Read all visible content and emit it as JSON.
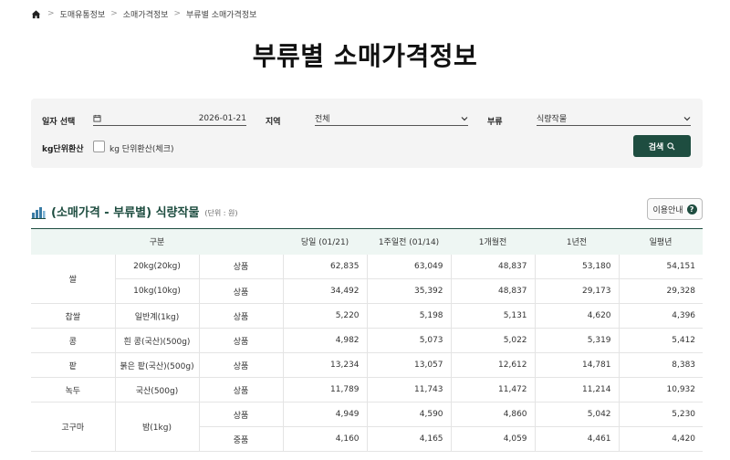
{
  "breadcrumb": {
    "items": [
      "도매유통정보",
      "소매가격정보",
      "부류별 소매가격정보"
    ]
  },
  "page": {
    "title": "부류별 소매가격정보"
  },
  "filters": {
    "date_label": "일자 선택",
    "date_value": "2026-01-21",
    "region_label": "지역",
    "region_value": "전체",
    "category_label": "부류",
    "category_value": "식량작물",
    "kg_label": "kg단위환산",
    "kg_checkbox_label": "kg 단위환산(체크)",
    "search_label": "검색"
  },
  "section": {
    "title": "(소매가격 - 부류별) 식량작물",
    "unit": "(단위 : 원)",
    "guide_label": "이용안내"
  },
  "table": {
    "headers": {
      "category": "구분",
      "today": "당일 (01/21)",
      "week": "1주일전 (01/14)",
      "month": "1개월전",
      "year": "1년전",
      "avg": "일평년"
    },
    "rows": [
      {
        "item": "쌀",
        "variety": "20kg(20kg)",
        "grade": "상품",
        "today": "62,835",
        "week": "63,049",
        "month": "48,837",
        "year": "53,180",
        "avg": "54,151"
      },
      {
        "item": "",
        "variety": "10kg(10kg)",
        "grade": "상품",
        "today": "34,492",
        "week": "35,392",
        "month": "48,837",
        "year": "29,173",
        "avg": "29,328"
      },
      {
        "item": "찹쌀",
        "variety": "일반계(1kg)",
        "grade": "상품",
        "today": "5,220",
        "week": "5,198",
        "month": "5,131",
        "year": "4,620",
        "avg": "4,396"
      },
      {
        "item": "콩",
        "variety": "흰 콩(국산)(500g)",
        "grade": "상품",
        "today": "4,982",
        "week": "5,073",
        "month": "5,022",
        "year": "5,319",
        "avg": "5,412"
      },
      {
        "item": "팥",
        "variety": "붉은 팥(국산)(500g)",
        "grade": "상품",
        "today": "13,234",
        "week": "13,057",
        "month": "12,612",
        "year": "14,781",
        "avg": "8,383"
      },
      {
        "item": "녹두",
        "variety": "국산(500g)",
        "grade": "상품",
        "today": "11,789",
        "week": "11,743",
        "month": "11,472",
        "year": "11,214",
        "avg": "10,932"
      },
      {
        "item": "고구마",
        "variety": "밤(1kg)",
        "grade": "상품",
        "today": "4,949",
        "week": "4,590",
        "month": "4,860",
        "year": "5,042",
        "avg": "5,230"
      },
      {
        "item": "",
        "variety": "",
        "grade": "중품",
        "today": "4,160",
        "week": "4,165",
        "month": "4,059",
        "year": "4,461",
        "avg": "4,420"
      }
    ]
  },
  "colors": {
    "accent": "#1e4d40",
    "header_bg": "#eef6f3",
    "filter_bg": "#f4f4f4"
  }
}
